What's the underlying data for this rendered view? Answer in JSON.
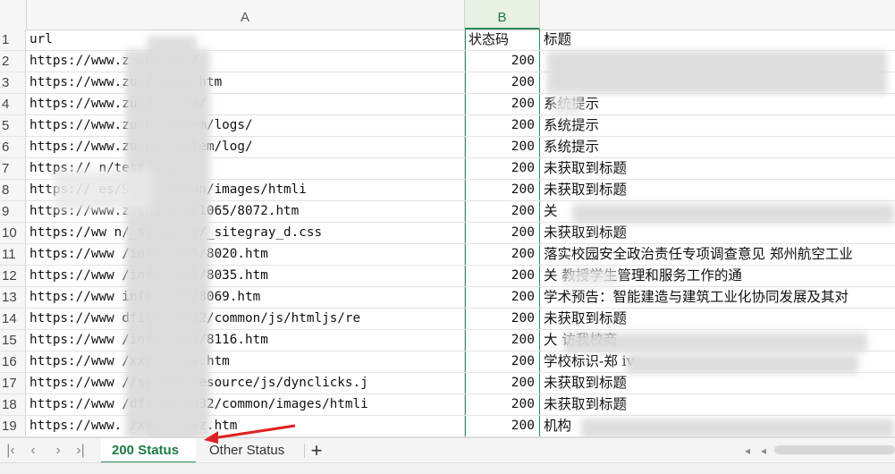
{
  "columns": {
    "a": "A",
    "b": "B"
  },
  "header_row": {
    "num": "1",
    "url": "url",
    "status": "状态码",
    "title": "标题"
  },
  "rows": [
    {
      "num": "2",
      "url": "https://www.z      .cn/%3F/",
      "status": "200",
      "title": ""
    },
    {
      "num": "3",
      "url": "https://www.zu         /index.htm",
      "status": "200",
      "title": ""
    },
    {
      "num": "4",
      "url": "https://www.zu          /system/",
      "status": "200",
      "title": "系统提示"
    },
    {
      "num": "5",
      "url": "https://www.zu         n/system/logs/",
      "status": "200",
      "title": "系统提示"
    },
    {
      "num": "6",
      "url": "https://www.zu         cn/system/log/",
      "status": "200",
      "title": "系统提示"
    },
    {
      "num": "7",
      "url": "https://          n/test.jsp",
      "status": "200",
      "title": "未获取到标题"
    },
    {
      "num": "8",
      "url": "https://          es/9832/common/images/htmli",
      "status": "200",
      "title": "未获取到标题"
    },
    {
      "num": "9",
      "url": "https://www.z        cn/info/1065/8072.htm",
      "status": "200",
      "title": "关"
    },
    {
      "num": "10",
      "url": "https://ww         n/_sitegray/_sitegray_d.css",
      "status": "200",
      "title": "未获取到标题"
    },
    {
      "num": "11",
      "url": "https://www          /info/1065/8020.htm",
      "status": "200",
      "title": "落实校园安全政治责任专项调查意见 郑州航空工业"
    },
    {
      "num": "12",
      "url": "https://www          /info/1065/8035.htm",
      "status": "200",
      "title": "关      教授学生管理和服务工作的通"
    },
    {
      "num": "13",
      "url": "https://www          info/1066/8069.htm",
      "status": "200",
      "title": "学术预告：智能建造与建筑工业化协同发展及其对"
    },
    {
      "num": "14",
      "url": "https://www          dfiles/9832/common/js/htmljs/re",
      "status": "200",
      "title": "未获取到标题"
    },
    {
      "num": "15",
      "url": "https://www          /info/1064/8116.htm",
      "status": "200",
      "title": "大                   访我校商"
    },
    {
      "num": "16",
      "url": "https://www          /xxgk/xxbs.htm",
      "status": "200",
      "title": "学校标识-郑             iv"
    },
    {
      "num": "17",
      "url": "https://www         //system/resource/js/dynclicks.j",
      "status": "200",
      "title": "未获取到标题"
    },
    {
      "num": "18",
      "url": "https://www          /dfiles/9832/common/images/htmli",
      "status": "200",
      "title": "未获取到标题"
    },
    {
      "num": "19",
      "url": "https://www.        /xxgk/jgsz.htm",
      "status": "200",
      "title": "机构"
    }
  ],
  "tabs": {
    "active": "200 Status",
    "other": "Other Status",
    "add": "+"
  },
  "nav": {
    "first": "|‹",
    "prev": "‹",
    "next": "›",
    "last": "›|"
  },
  "colors": {
    "accent": "#1e7a45",
    "arrow": "#e02020"
  }
}
